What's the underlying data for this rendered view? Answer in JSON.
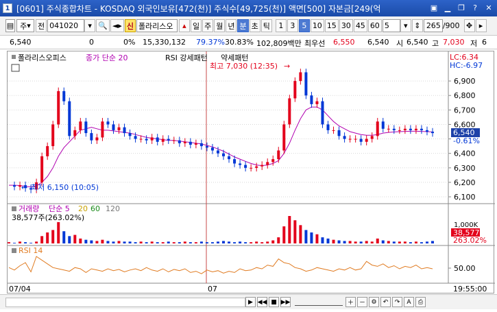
{
  "window": {
    "icon_label": "1",
    "title": "[0601] 주식종합차트 - KOSDAQ 외국인보유[472(천)] 주식수[49,725(천)] 액면[500] 자본금[249(억"
  },
  "toolbar": {
    "code_prefix": "주",
    "period_label": "전",
    "code_value": "041020",
    "sin_label": "신",
    "name_value": "폴라리스오",
    "period_buttons": [
      "일",
      "주",
      "월",
      "년",
      "분",
      "초",
      "틱"
    ],
    "active_period": "분",
    "interval_buttons": [
      "1",
      "3",
      "5",
      "10",
      "15",
      "30",
      "45",
      "60"
    ],
    "active_interval": "5",
    "custom_interval": "5",
    "count_value": "265",
    "count_total": "/900"
  },
  "quote": {
    "price": "6,540",
    "change": "0",
    "change_pct": "0%",
    "volume": "15,330,132",
    "vol_ratio": "79.37%",
    "turnover": "30.83%",
    "amount": "102,809백만",
    "best_ask_label": "최우선",
    "best_ask": "6,550",
    "best_bid": "6,540",
    "open_label": "시",
    "open": "6,540",
    "high_label": "고",
    "high": "7,030",
    "low_label": "저",
    "low": "6"
  },
  "chart": {
    "legend": {
      "name": "폴라리스오피스",
      "ma": "종가 단순 20",
      "rsi_pattern": "RSI 강세패턴",
      "weak_pattern": "약세패턴"
    },
    "lc": "LC:6.34",
    "hc": "HC:-6.97",
    "high_marker": "최고 7,030 (12:35)",
    "low_marker": "최저 6,150 (10:05)",
    "price_axis": [
      "6,900",
      "6,800",
      "6,700",
      "6,600",
      "6,500",
      "6,400",
      "6,300",
      "6,200",
      "6,100"
    ],
    "current_price": "6,540",
    "current_pct": "-0.61%",
    "volume_legend": {
      "name": "거래량",
      "ma": "단순 5",
      "ma20": "20",
      "ma60": "60",
      "ma120": "120",
      "value": "38,577주(263.02%)"
    },
    "volume_axis": "1,000K",
    "volume_current": "38,577",
    "volume_pct": "263.02%",
    "rsi_legend": "RSI 14",
    "rsi_axis": "50.00",
    "date_left": "07/04",
    "date_mid": "07",
    "time_right": "19:55:00",
    "colors": {
      "up": "#e3001b",
      "down": "#0037d6",
      "ma_price": "#b000b0",
      "rsi": "#e07a1f",
      "divider": "#c84a4a"
    }
  },
  "series": {
    "price_path": [
      6180,
      6170,
      6180,
      6160,
      6150,
      6200,
      6380,
      6450,
      6600,
      6830,
      6760,
      6520,
      6560,
      6620,
      6540,
      6490,
      6510,
      6620,
      6600,
      6560,
      6580,
      6540,
      6520,
      6500,
      6500,
      6490,
      6510,
      6480,
      6500,
      6490,
      6490,
      6470,
      6480,
      6460,
      6470,
      6450,
      6440,
      6420,
      6400,
      6380,
      6360,
      6330,
      6320,
      6300,
      6300,
      6310,
      6320,
      6340,
      6360,
      6420,
      6600,
      6780,
      6900,
      6960,
      6800,
      6740,
      6760,
      6600,
      6560,
      6560,
      6520,
      6500,
      6500,
      6500,
      6480,
      6500,
      6520,
      6620,
      6570,
      6570,
      6560,
      6560,
      6570,
      6560,
      6570,
      6560,
      6550,
      6540
    ],
    "ma_path": [
      6180,
      6180,
      6178,
      6172,
      6168,
      6175,
      6200,
      6240,
      6300,
      6380,
      6440,
      6480,
      6520,
      6560,
      6570,
      6580,
      6570,
      6560,
      6560,
      6555,
      6550,
      6545,
      6540,
      6530,
      6520,
      6510,
      6505,
      6500,
      6495,
      6490,
      6490,
      6485,
      6480,
      6475,
      6470,
      6465,
      6455,
      6445,
      6430,
      6415,
      6395,
      6375,
      6360,
      6345,
      6330,
      6320,
      6315,
      6320,
      6330,
      6350,
      6400,
      6470,
      6560,
      6640,
      6700,
      6720,
      6720,
      6700,
      6660,
      6620,
      6590,
      6570,
      6550,
      6540,
      6530,
      6525,
      6525,
      6530,
      6540,
      6545,
      6548,
      6550,
      6552,
      6553,
      6553,
      6552,
      6550,
      6548
    ],
    "rsi_path": [
      52,
      48,
      55,
      60,
      45,
      70,
      64,
      58,
      52,
      50,
      48,
      46,
      52,
      50,
      44,
      50,
      48,
      46,
      50,
      47,
      49,
      45,
      48,
      50,
      47,
      52,
      48,
      46,
      50,
      45,
      49,
      47,
      50,
      44,
      46,
      42,
      48,
      45,
      47,
      43,
      46,
      44,
      50,
      47,
      48,
      52,
      50,
      56,
      54,
      66,
      60,
      58,
      52,
      50,
      46,
      48,
      52,
      50,
      48,
      46,
      50,
      48,
      52,
      48,
      50,
      62,
      56,
      54,
      58,
      52,
      55,
      50,
      54,
      52,
      56,
      50,
      52,
      50
    ],
    "volume_bars": [
      2,
      1,
      3,
      2,
      1,
      3,
      12,
      18,
      22,
      35,
      20,
      12,
      14,
      8,
      6,
      5,
      4,
      6,
      4,
      3,
      4,
      3,
      3,
      2,
      3,
      2,
      3,
      2,
      2,
      3,
      2,
      2,
      3,
      2,
      2,
      3,
      2,
      2,
      3,
      4,
      3,
      2,
      3,
      2,
      2,
      3,
      2,
      3,
      5,
      10,
      28,
      45,
      38,
      30,
      22,
      18,
      15,
      10,
      8,
      6,
      5,
      4,
      4,
      3,
      3,
      4,
      3,
      8,
      5,
      4,
      3,
      3,
      3,
      2,
      3,
      2,
      3,
      4
    ]
  }
}
